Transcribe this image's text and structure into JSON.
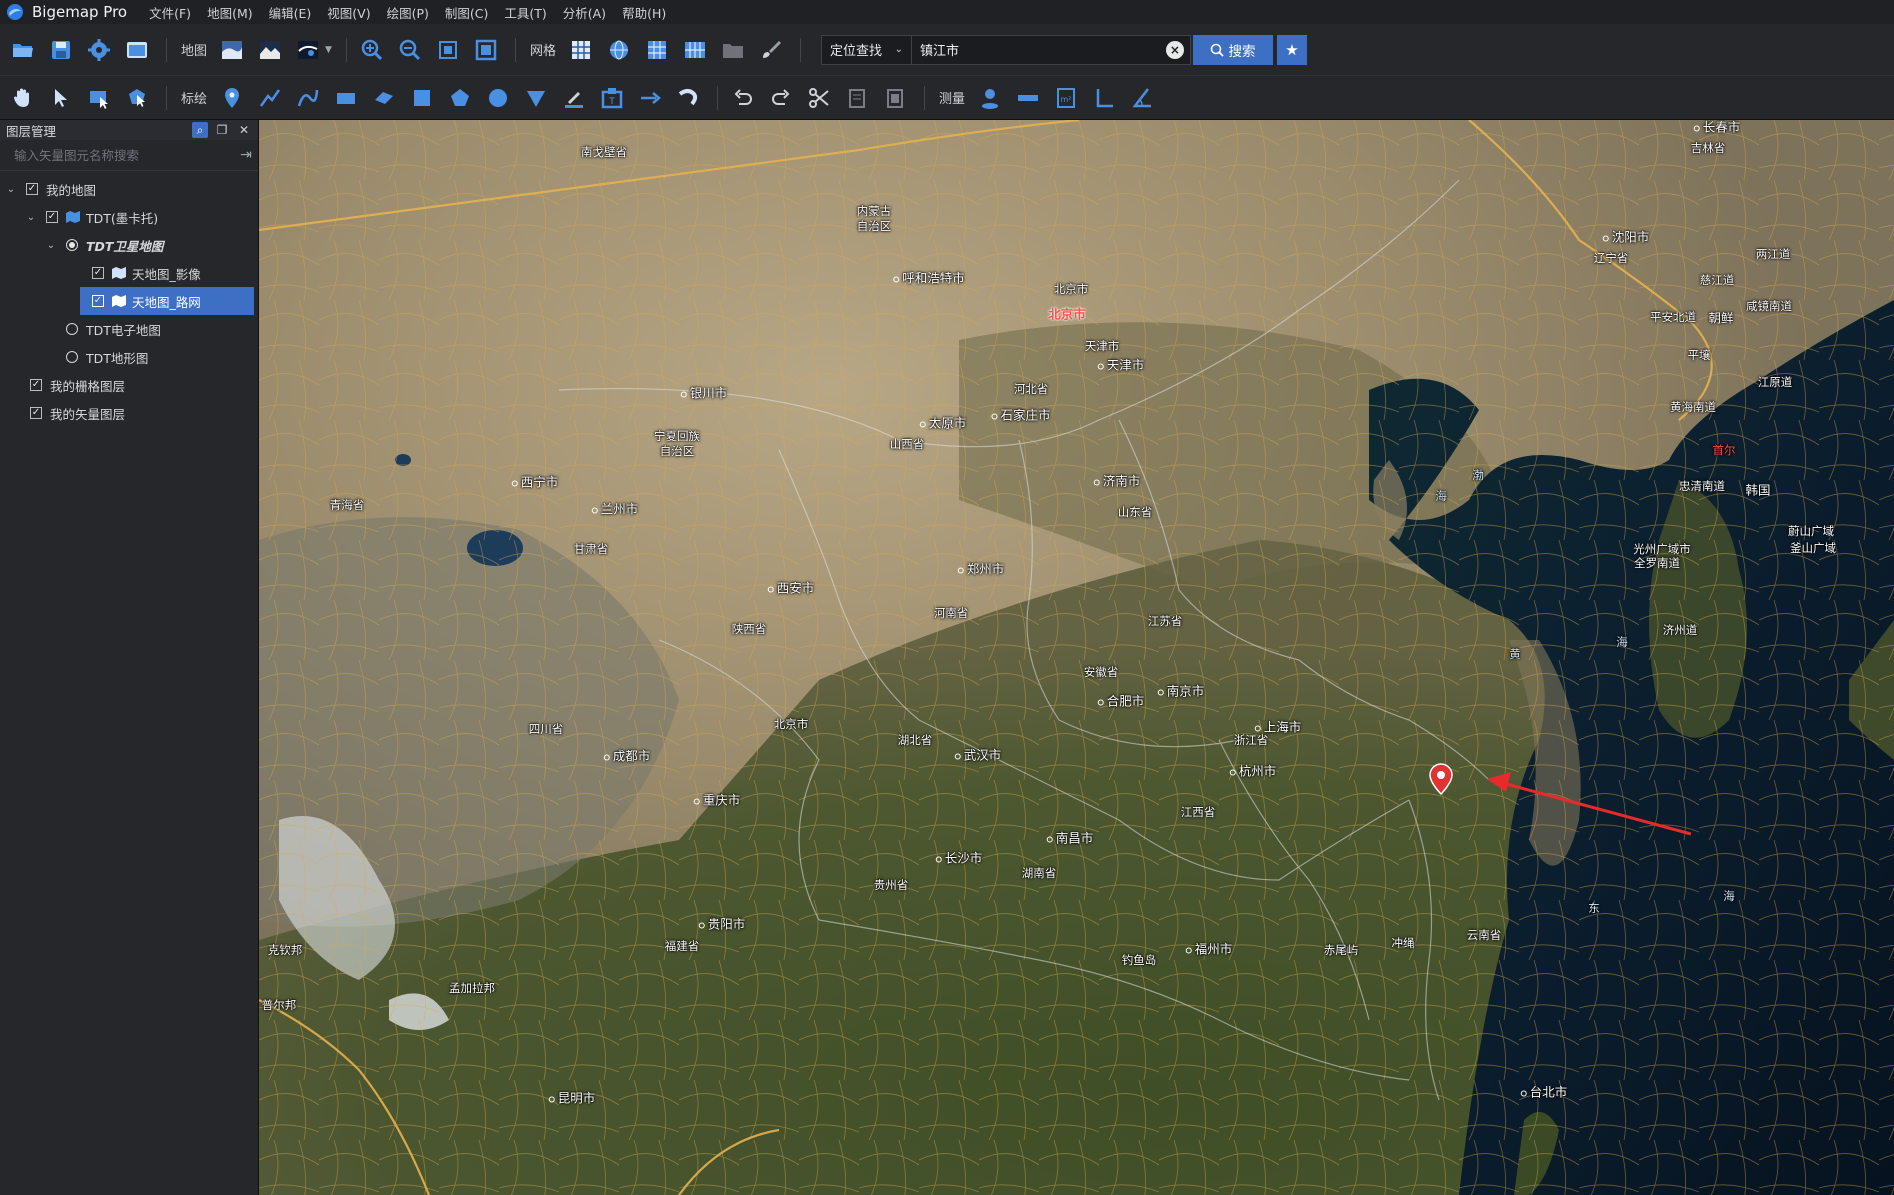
{
  "app": {
    "name": "Bigemap Pro",
    "logo_icon": "bigemap-logo-icon"
  },
  "menu": [
    "文件(F)",
    "地图(M)",
    "编辑(E)",
    "视图(V)",
    "绘图(P)",
    "制图(C)",
    "工具(T)",
    "分析(A)",
    "帮助(H)"
  ],
  "toolbar1": {
    "map_label": "地图",
    "grid_label": "网格",
    "search": {
      "mode": "定位查找",
      "value": "镇江市",
      "button_label": "搜索"
    }
  },
  "toolbar2": {
    "draw_label": "标绘",
    "measure_label": "测量"
  },
  "layer_panel": {
    "title": "图层管理",
    "search_placeholder": "输入矢量图元名称搜索",
    "tree": [
      {
        "label": "我的地图",
        "level": 0,
        "checked": true
      },
      {
        "label": "TDT(墨卡托)",
        "level": 1,
        "checked": true
      },
      {
        "label": "TDT卫星地图",
        "level": 2,
        "radio": true,
        "selected_radio": true
      },
      {
        "label": "天地图_影像",
        "level": 3,
        "checked": true
      },
      {
        "label": "天地图_路网",
        "level": 3,
        "checked": true,
        "highlighted": true
      },
      {
        "label": "TDT电子地图",
        "level": 2,
        "radio": true
      },
      {
        "label": "TDT地形图",
        "level": 2,
        "radio": true
      },
      {
        "label": "我的栅格图层",
        "level": 0,
        "checked": true
      },
      {
        "label": "我的矢量图层",
        "level": 0,
        "checked": true
      }
    ]
  },
  "map": {
    "capital": "北京市",
    "korea_capital": "首尔",
    "pyongyang": "平壤",
    "cities": [
      "长春市",
      "沈阳市",
      "呼和浩特市",
      "北京市",
      "天津市",
      "石家庄市",
      "太原市",
      "银川市",
      "济南市",
      "西宁市",
      "兰州市",
      "郑州市",
      "西安市",
      "合肥市",
      "南京市",
      "上海市",
      "成都市",
      "重庆市",
      "武汉市",
      "杭州市",
      "长沙市",
      "南昌市",
      "贵阳市",
      "福州市",
      "昆明市",
      "台北市"
    ],
    "regions": [
      "吉林省",
      "南戈壁省",
      "内蒙古",
      "自治区",
      "辽宁省",
      "两江道",
      "慈江道",
      "咸镜南道",
      "平安北道",
      "朝鲜",
      "天津市",
      "河北省",
      "江原道",
      "黄海南道",
      "宁夏回族",
      "自治区",
      "山西省",
      "青海省",
      "山东省",
      "忠清南道",
      "韩国",
      "甘肃省",
      "蔚山广域",
      "釜山广域",
      "光州广域市",
      "全罗南道",
      "河南省",
      "江苏省",
      "济州道",
      "陕西省",
      "安徽省",
      "四川省",
      "湖北省",
      "上海市",
      "浙江省",
      "江西省",
      "湖南省",
      "贵州省",
      "福建省",
      "钓鱼岛",
      "赤尾屿",
      "冲绳",
      "云南省",
      "孟加拉邦",
      "克钦邦",
      "普尔邦",
      "北京市"
    ],
    "sea_labels": [
      "渤",
      "海",
      "黄",
      "海",
      "东",
      "海",
      "海"
    ]
  }
}
